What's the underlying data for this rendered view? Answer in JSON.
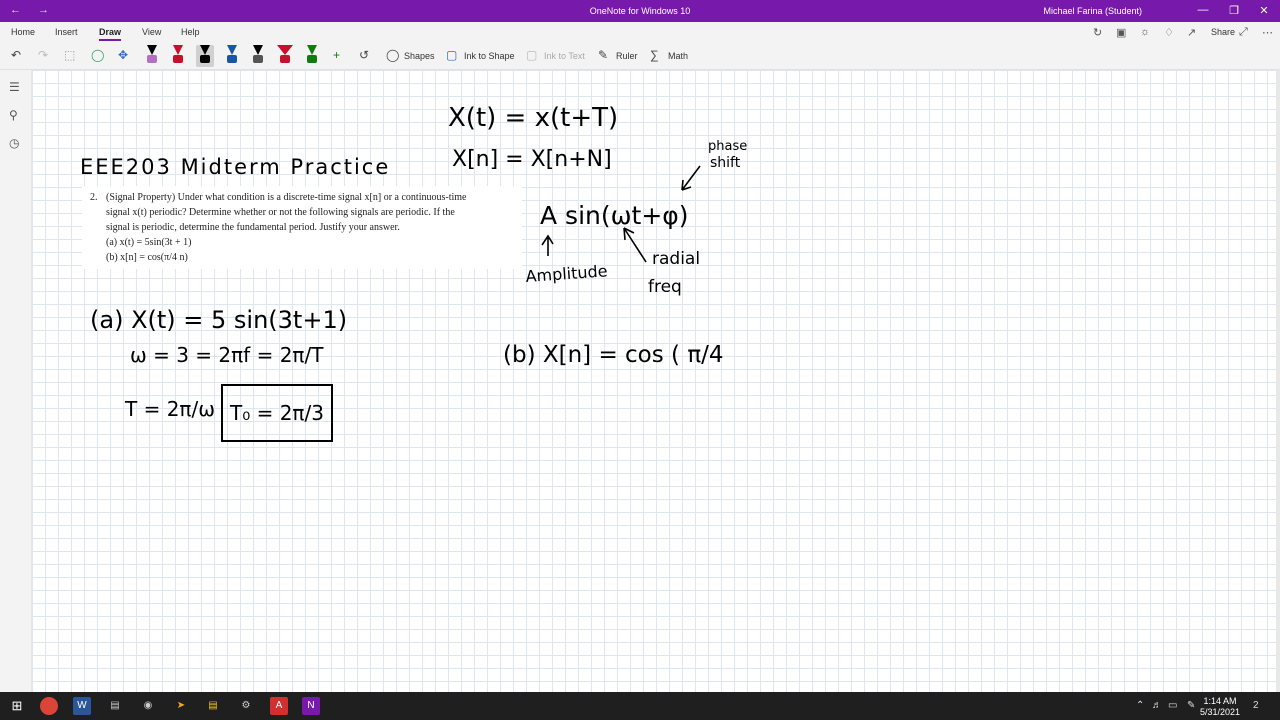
{
  "titlebar": {
    "app_title": "OneNote for Windows 10",
    "user": "Michael Farina (Student)"
  },
  "menu": {
    "tabs": [
      "Home",
      "Insert",
      "Draw",
      "View",
      "Help"
    ],
    "active_tab": "Draw",
    "share_label": "Share"
  },
  "toolbar": {
    "shapes_label": "Shapes",
    "ink_to_shape_label": "Ink to Shape",
    "ink_to_text_label": "Ink to Text",
    "ruler_label": "Ruler",
    "math_label": "Math",
    "pen_colors": [
      "#b36fc4",
      "#c8102e",
      "#000000",
      "#1a56a6",
      "#000000",
      "#c8102e",
      "#107c10"
    ]
  },
  "problem": {
    "number": "2.",
    "line1": "(Signal Property) Under what condition is a discrete-time signal x[n] or a continuous-time",
    "line2": "signal x(t) periodic? Determine whether or not the following signals are periodic. If the",
    "line3": "signal is periodic, determine the fundamental period. Justify your answer.",
    "part_a": "(a) x(t) = 5sin(3t + 1)",
    "part_b": "(b) x[n] = cos(π/4 n)"
  },
  "ink": {
    "heading": "EEE203 Midterm Practice",
    "eq_ct": "X(t) = x(t+T)",
    "eq_dt": "X[n] = X[n+N]",
    "phase": "phase",
    "shift": "shift",
    "sinusoid": "A sin(ωt+φ)",
    "amplitude": "Amplitude",
    "radial": "radial",
    "freq": "freq",
    "a_line1": "(a) X(t) = 5 sin(3t+1)",
    "a_line2": "ω = 3 = 2πf = 2π/T",
    "a_line3": "T = 2π/ω",
    "a_answer": "T₀ = 2π/3",
    "b_line1": "(b) X[n] = cos ( π/4"
  },
  "taskbar": {
    "time": "1:14 AM",
    "date": "5/31/2021",
    "notification_count": "2"
  }
}
